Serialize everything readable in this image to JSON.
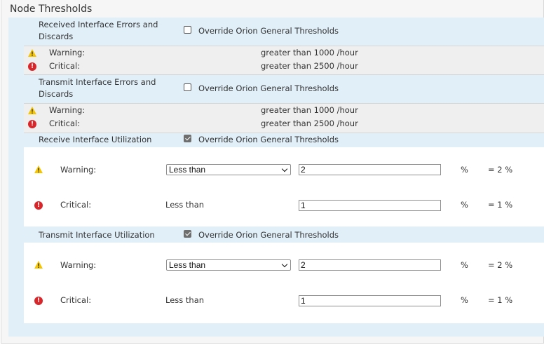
{
  "section_title": "Node Thresholds",
  "override_label": "Override Orion General Thresholds",
  "levels": {
    "warning": "Warning:",
    "critical": "Critical:"
  },
  "received_errors": {
    "label_line1": "Received Interface Errors and",
    "label_line2": "Discards",
    "override_checked": false,
    "warning_value": "greater than 1000 /hour",
    "critical_value": "greater than 2500 /hour"
  },
  "transmit_errors": {
    "label_line1": "Transmit Interface Errors and",
    "label_line2": "Discards",
    "override_checked": false,
    "warning_value": "greater than 1000 /hour",
    "critical_value": "greater than 2500 /hour"
  },
  "receive_util": {
    "label": "Receive Interface Utilization",
    "override_checked": true,
    "warning_operator": "Less than",
    "warning_value": "2",
    "warning_unit": "%",
    "warning_summary": "= 2 %",
    "critical_operator": "Less than",
    "critical_value": "1",
    "critical_unit": "%",
    "critical_summary": "= 1 %"
  },
  "transmit_util": {
    "label": "Transmit Interface Utilization",
    "override_checked": true,
    "warning_operator": "Less than",
    "warning_value": "2",
    "warning_unit": "%",
    "warning_summary": "= 2 %",
    "critical_operator": "Less than",
    "critical_value": "1",
    "critical_unit": "%",
    "critical_summary": "= 1 %"
  },
  "colors": {
    "panel_blue": "#e1eff8",
    "warning": "#f5c400",
    "critical": "#d9262b"
  }
}
